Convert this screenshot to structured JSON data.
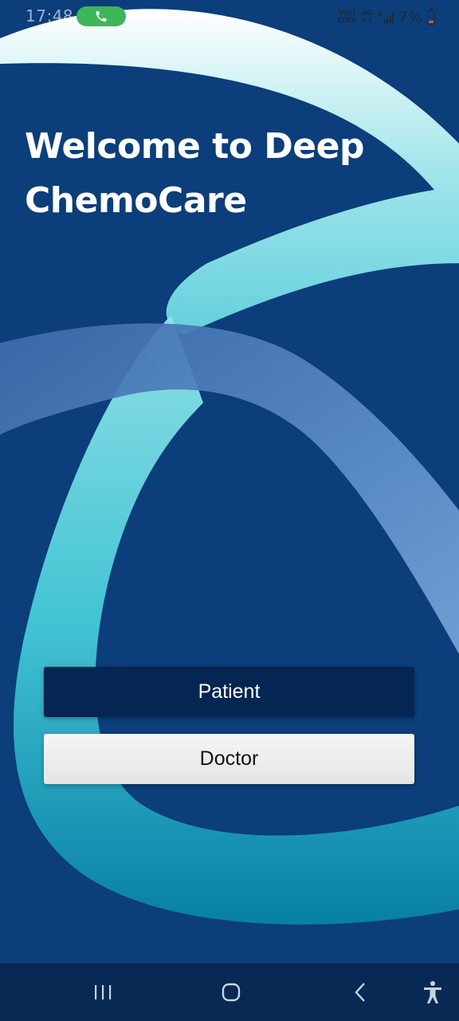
{
  "status_bar": {
    "time": "17:48",
    "network_top": "Vo))",
    "network_bottom": "LTE2",
    "data_top": "4G",
    "data_bottom": "↓↑",
    "roaming": "R",
    "battery_percent": "7%"
  },
  "welcome": {
    "title": "Welcome to Deep ChemoCare"
  },
  "actions": {
    "patient_label": "Patient",
    "doctor_label": "Doctor"
  },
  "icons": {
    "call": "phone-icon",
    "signal": "signal-icon",
    "battery": "battery-icon",
    "recents": "recents-icon",
    "home": "home-icon",
    "back": "back-icon",
    "accessibility": "accessibility-icon"
  },
  "colors": {
    "background": "#0b3e7a",
    "patient_button": "#052552",
    "doctor_button": "#eeeeee",
    "call_pill": "#3fb55a",
    "battery_low": "#e34b3b",
    "nav_bar": "#082954"
  }
}
